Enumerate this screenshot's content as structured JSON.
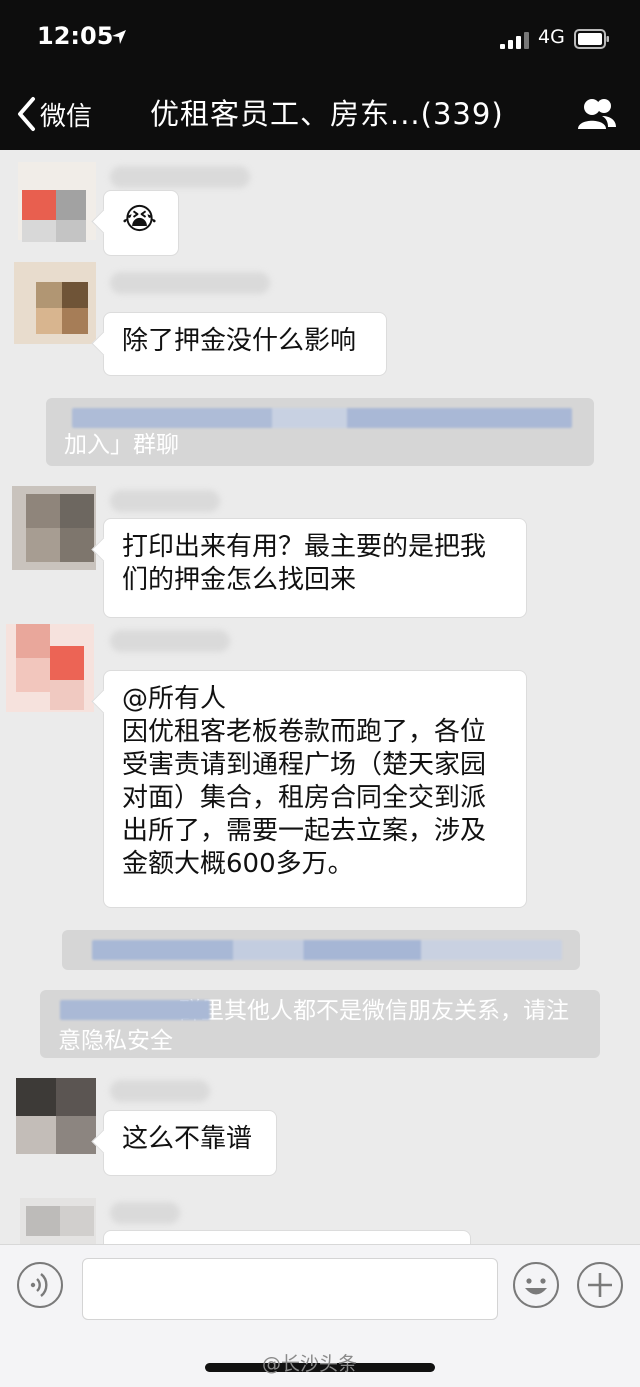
{
  "status": {
    "time": "12:05",
    "network": "4G"
  },
  "nav": {
    "back_label": "微信",
    "title": "优租客员工、房东...(339)"
  },
  "messages": {
    "m1": {
      "emoji": "😭"
    },
    "m2": {
      "text": "除了押金没什么影响"
    },
    "sys1": {
      "text": "加入」群聊"
    },
    "m3": {
      "line1": "打印出来有用？最主要的是把我",
      "line2": "们的押金怎么找回来"
    },
    "m4": {
      "line1": "@所有人",
      "line2": "因优租客老板卷款而跑了，各位",
      "line3": "受害责请到通程广场（楚天家园",
      "line4": "对面）集合，租房合同全交到派",
      "line5": "出所了，需要一起去立案，涉及",
      "line6": "金额大概600多万。"
    },
    "sys3": {
      "line1": "群里其他人都不是微信朋友关系，请注",
      "line2": "意隐私安全"
    },
    "m5": {
      "text": "这么不靠谱"
    }
  },
  "watermark": "@长沙头条",
  "colors": {
    "bar": "#0d0d0d",
    "chat_bg": "#ebebeb",
    "bubble": "#ffffff",
    "system_notice": "#d6d6d6"
  }
}
